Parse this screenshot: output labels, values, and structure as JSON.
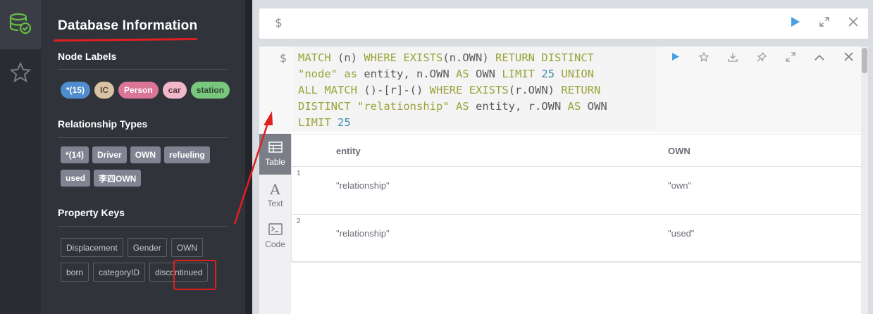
{
  "sidebar": {
    "title": "Database Information",
    "node_labels_title": "Node Labels",
    "node_labels": [
      {
        "label": "*(15)",
        "color": "#4f8ccd"
      },
      {
        "label": "IC",
        "color": "#d9c3a5",
        "text": "#5b4a3b"
      },
      {
        "label": "Person",
        "color": "#d97596"
      },
      {
        "label": "car",
        "color": "#f0b8c8",
        "text": "#5b3a44"
      },
      {
        "label": "station",
        "color": "#79c77f",
        "text": "#2f4a30"
      }
    ],
    "relationship_types_title": "Relationship Types",
    "relationship_types": [
      "*(14)",
      "Driver",
      "OWN",
      "refueling",
      "used",
      "李四OWN"
    ],
    "property_keys_title": "Property Keys",
    "property_keys": [
      "Displacement",
      "Gender",
      "OWN",
      "born",
      "categoryID",
      "discontinued"
    ]
  },
  "editor": {
    "prompt": "$"
  },
  "frame": {
    "prompt": "$",
    "query": {
      "line1": [
        "MATCH",
        " (n) ",
        "WHERE",
        " ",
        "EXISTS",
        "(n.OWN) ",
        "RETURN",
        " ",
        "DISTINCT"
      ],
      "line2": [
        "\"node\"",
        " ",
        "as",
        " entity, n.OWN ",
        "AS",
        " OWN ",
        "LIMIT",
        " ",
        "25",
        " ",
        "UNION"
      ],
      "line3": [
        "ALL",
        " ",
        "MATCH",
        " ()-[r]-() ",
        "WHERE",
        " ",
        "EXISTS",
        "(r.OWN) ",
        "RETURN"
      ],
      "line4": [
        "DISTINCT",
        " ",
        "\"relationship\"",
        " ",
        "AS",
        " entity, r.OWN ",
        "AS",
        " OWN"
      ],
      "line5": [
        "LIMIT",
        " ",
        "25"
      ]
    },
    "view_tabs": [
      {
        "label": "Table",
        "icon": "table-icon"
      },
      {
        "label": "Text",
        "icon": "text-icon"
      },
      {
        "label": "Code",
        "icon": "code-icon"
      }
    ],
    "table": {
      "columns": [
        "entity",
        "OWN"
      ],
      "rows": [
        {
          "num": "1",
          "entity": "\"relationship\"",
          "own": "\"own\""
        },
        {
          "num": "2",
          "entity": "\"relationship\"",
          "own": "\"used\""
        }
      ]
    }
  },
  "colors": {
    "accent_green": "#68bd45",
    "run_blue": "#4b9fe1",
    "annotation_red": "#e02020"
  }
}
